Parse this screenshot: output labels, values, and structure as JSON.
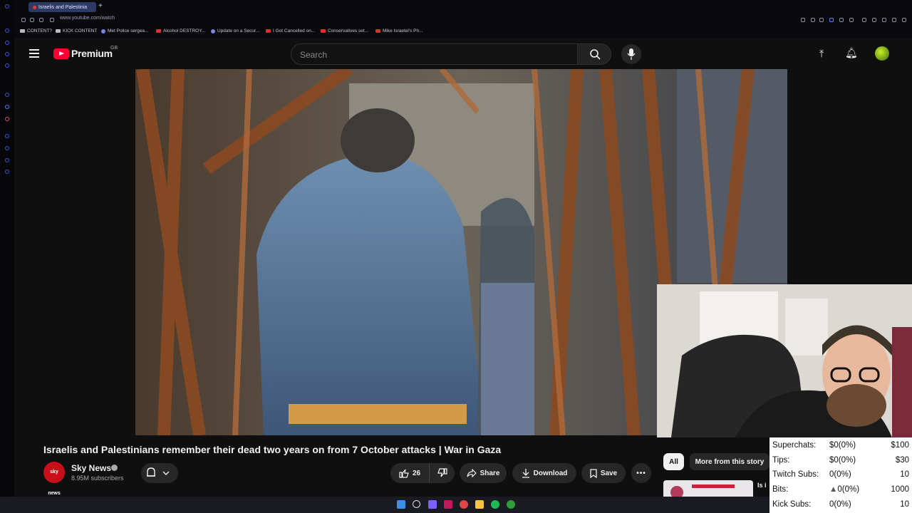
{
  "browser": {
    "tab_title": "Israelis and Palestinia",
    "new_tab": "+",
    "url": "www.youtube.com/watch",
    "bookmarks": [
      {
        "label": "CONTENT?",
        "kind": "folder"
      },
      {
        "label": "KICK CONTENT",
        "kind": "folder"
      },
      {
        "label": "Met Police sergea...",
        "kind": "blue"
      },
      {
        "label": "Alcohol DESTROY...",
        "kind": "yt"
      },
      {
        "label": "Update on a Secur...",
        "kind": "blue"
      },
      {
        "label": "I Got Cancelled on...",
        "kind": "yt"
      },
      {
        "label": "Conservatives set...",
        "kind": "yt"
      },
      {
        "label": "Mike Israetel's Ph...",
        "kind": "yt"
      }
    ]
  },
  "youtube": {
    "logo_text": "Premium",
    "region": "GB",
    "search_placeholder": "Search",
    "video_title": "Israelis and Palestinians remember their dead two years on from 7 October attacks | War in Gaza",
    "channel": {
      "avatar_text": "sky news",
      "name": "Sky News",
      "subscribers": "8.95M subscribers"
    },
    "actions": {
      "likes": "26",
      "share": "Share",
      "download": "Download",
      "save": "Save"
    },
    "chips": {
      "all": "All",
      "more": "More from this story"
    },
    "recommended_title_fragment": "Is i"
  },
  "stats_overlay": {
    "rows": [
      {
        "label": "Superchats:",
        "value": "$0(0%)",
        "goal": "$100"
      },
      {
        "label": "Tips:",
        "value": "$0(0%)",
        "goal": "$30"
      },
      {
        "label": "Twitch Subs:",
        "value": "0(0%)",
        "goal": "10"
      },
      {
        "label": "Bits:",
        "value": "0(0%)",
        "goal": "1000"
      },
      {
        "label": "Kick Subs:",
        "value": "0(0%)",
        "goal": "10"
      }
    ]
  },
  "colors": {
    "youtube_red": "#ff0033",
    "background": "#0f0f0f",
    "chip_active": "#f1f1f1"
  }
}
